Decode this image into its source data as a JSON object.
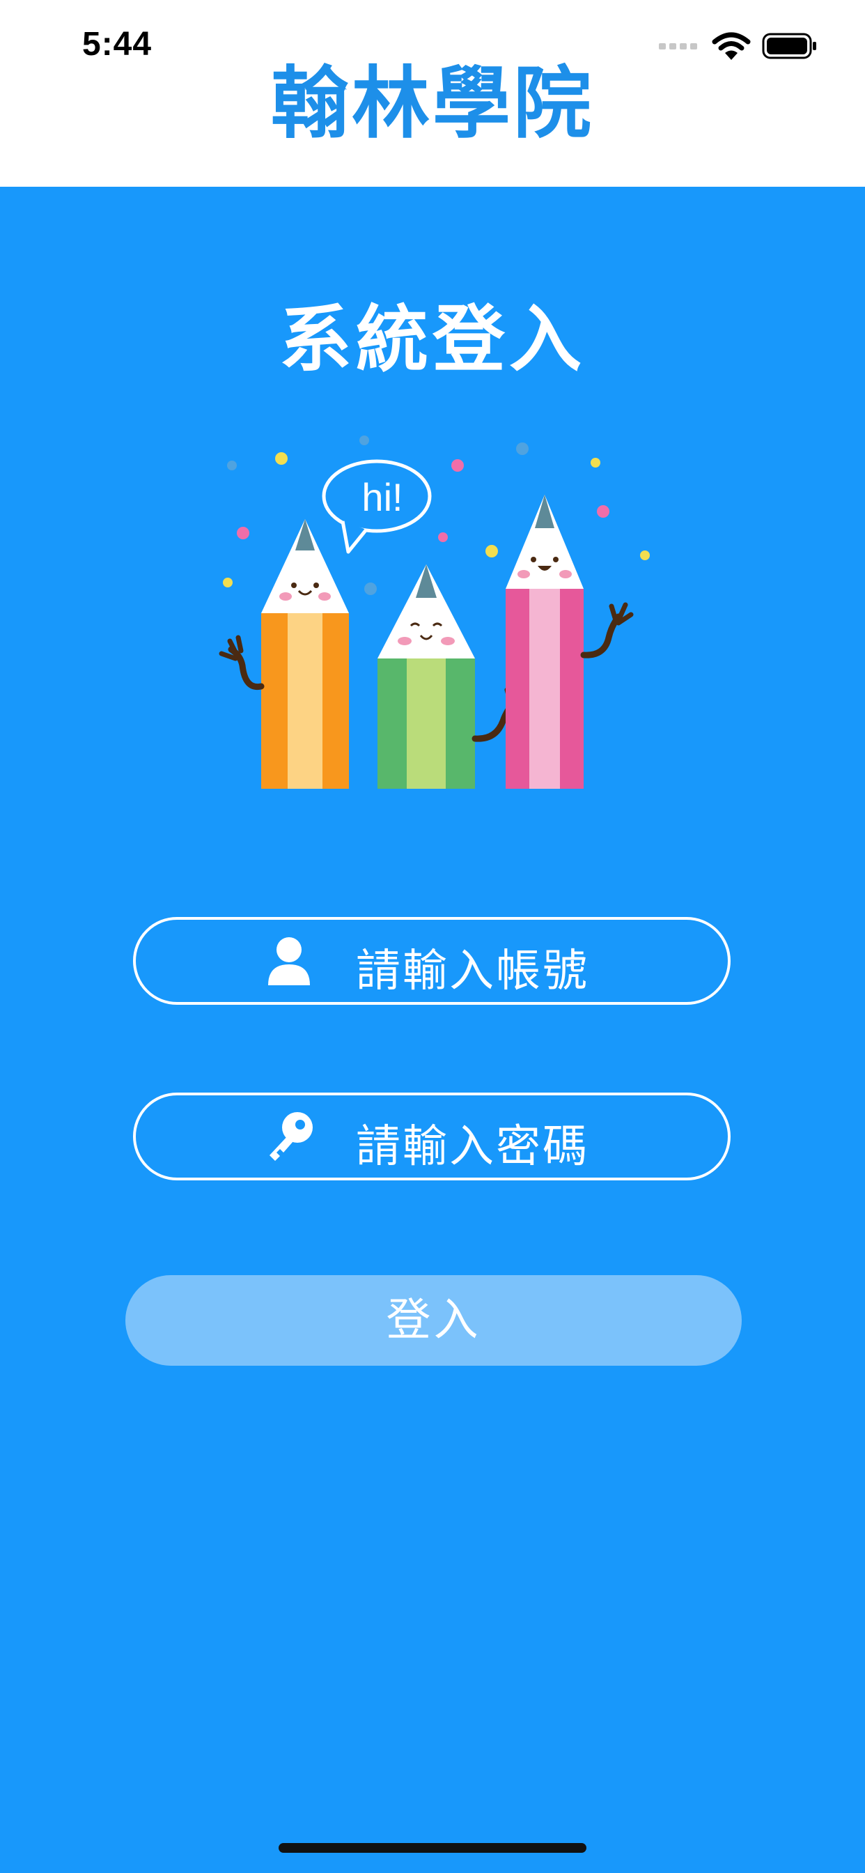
{
  "status_bar": {
    "time": "5:44"
  },
  "header": {
    "title": "翰林學院"
  },
  "login": {
    "title": "系統登入",
    "speech_bubble": "hi!",
    "account_placeholder": "請輸入帳號",
    "password_placeholder": "請輸入密碼",
    "submit_label": "登入"
  },
  "colors": {
    "background": "#1898fb",
    "header_title": "#1d8fe9",
    "button_disabled": "#7bc2fb",
    "pencil_orange": "#f8971d",
    "pencil_green": "#58b76b",
    "pencil_pink": "#e6589a"
  },
  "icons": {
    "account": "person-icon",
    "password": "key-icon"
  }
}
